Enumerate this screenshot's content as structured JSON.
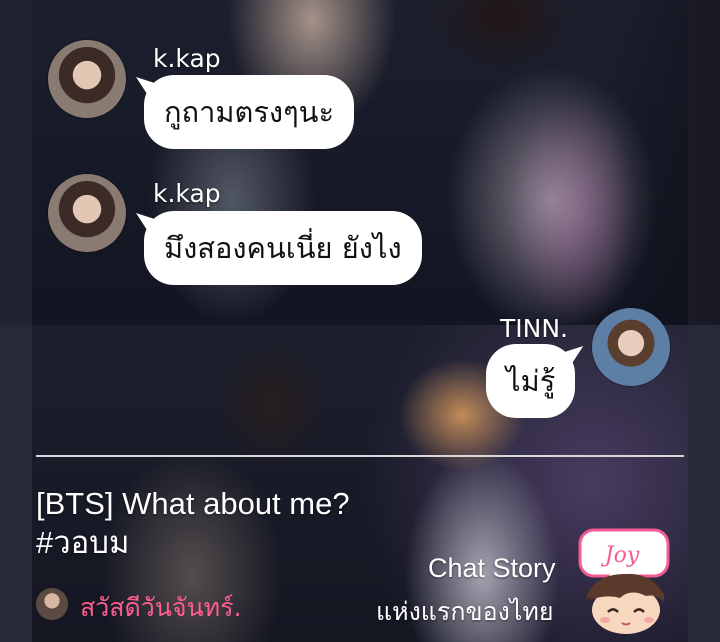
{
  "chat": {
    "messages": [
      {
        "sender": "k.kap",
        "text": "กูถามตรงๆนะ",
        "side": "left"
      },
      {
        "sender": "k.kap",
        "text": "มึงสองคนเนี่ย ยังไง",
        "side": "left"
      },
      {
        "sender": "TINN.",
        "text": "ไม่รู้",
        "side": "right"
      }
    ]
  },
  "story": {
    "title": "[BTS] What about me? #วอบม",
    "author": "สวัสดีวันจันทร์."
  },
  "brand": {
    "line1": "Chat Story",
    "line2": "แห่งแรกของไทย",
    "mascot_text": "Joy"
  },
  "colors": {
    "bubble": "#ffffff",
    "author": "#ff5d8f",
    "mascot_badge": "#f35b93"
  }
}
